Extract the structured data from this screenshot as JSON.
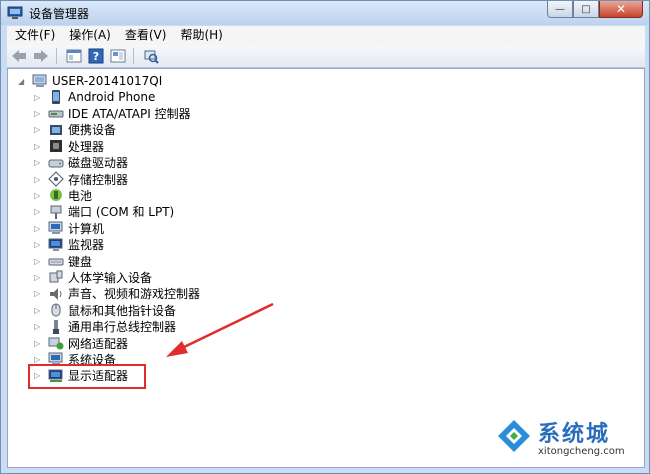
{
  "window": {
    "title": "设备管理器",
    "controls": {
      "minimize": "—",
      "maximize": "□",
      "close": "✕"
    }
  },
  "menu": [
    "文件(F)",
    "操作(A)",
    "查看(V)",
    "帮助(H)"
  ],
  "toolbar_icons": [
    "back-icon",
    "forward-icon",
    "properties-icon",
    "help-icon",
    "view-icon",
    "scan-hardware-icon"
  ],
  "tree": {
    "root": "USER-20141017QI",
    "items": [
      {
        "label": "Android Phone",
        "icon": "phone-icon"
      },
      {
        "label": "IDE ATA/ATAPI 控制器",
        "icon": "ide-controller-icon"
      },
      {
        "label": "便携设备",
        "icon": "portable-device-icon"
      },
      {
        "label": "处理器",
        "icon": "processor-icon"
      },
      {
        "label": "磁盘驱动器",
        "icon": "disk-drive-icon"
      },
      {
        "label": "存储控制器",
        "icon": "storage-controller-icon"
      },
      {
        "label": "电池",
        "icon": "battery-icon"
      },
      {
        "label": "端口 (COM 和 LPT)",
        "icon": "port-icon"
      },
      {
        "label": "计算机",
        "icon": "computer-icon"
      },
      {
        "label": "监视器",
        "icon": "monitor-icon"
      },
      {
        "label": "键盘",
        "icon": "keyboard-icon"
      },
      {
        "label": "人体学输入设备",
        "icon": "hid-icon"
      },
      {
        "label": "声音、视频和游戏控制器",
        "icon": "sound-icon"
      },
      {
        "label": "鼠标和其他指针设备",
        "icon": "mouse-icon"
      },
      {
        "label": "通用串行总线控制器",
        "icon": "usb-icon"
      },
      {
        "label": "网络适配器",
        "icon": "network-adapter-icon"
      },
      {
        "label": "系统设备",
        "icon": "system-device-icon"
      },
      {
        "label": "显示适配器",
        "icon": "display-adapter-icon"
      }
    ]
  },
  "watermark": {
    "brand": "系统城",
    "url": "xitongcheng.com"
  }
}
